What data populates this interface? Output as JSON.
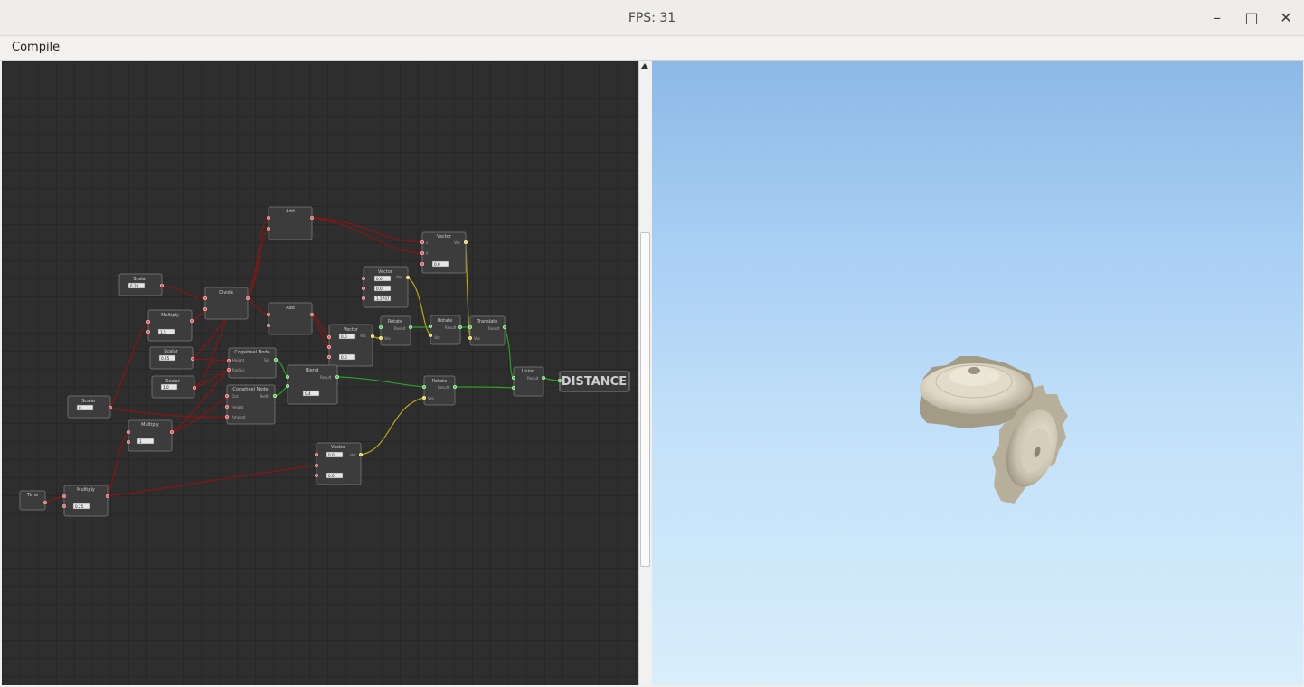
{
  "window": {
    "title": "FPS: 31",
    "minimize_glyph": "–",
    "maximize_glyph": "□",
    "close_glyph": "✕"
  },
  "menu": {
    "items": [
      {
        "label": "Compile"
      }
    ]
  },
  "graph": {
    "output_label": "DISTANCE",
    "nodes": [
      {
        "title": "Add",
        "inputs": [],
        "values": []
      },
      {
        "title": "Vector",
        "inputs": [
          "x",
          "y",
          "z"
        ],
        "outputs": [
          "Vec"
        ],
        "values": [
          "0.0"
        ]
      },
      {
        "title": "Scalar",
        "values": [
          "6.28"
        ]
      },
      {
        "title": "Divide",
        "values": []
      },
      {
        "title": "Vector",
        "outputs": [
          "Vec"
        ],
        "values": [
          "0.0",
          "0.0",
          "1.5707"
        ]
      },
      {
        "title": "Multiply",
        "values": [
          "1.5"
        ]
      },
      {
        "title": "Add",
        "values": []
      },
      {
        "title": "Vector",
        "outputs": [
          "Vec"
        ],
        "values": [
          "0.0",
          "0.0"
        ]
      },
      {
        "title": "Rotate",
        "inputs": [
          "Vec"
        ],
        "outputs": [
          "Result"
        ]
      },
      {
        "title": "Rotate",
        "inputs": [
          "Vec"
        ],
        "outputs": [
          "Result"
        ]
      },
      {
        "title": "Translate",
        "inputs": [
          "Vec"
        ],
        "outputs": [
          "Result"
        ]
      },
      {
        "title": "Scalar",
        "values": [
          "0.25"
        ]
      },
      {
        "title": "Cogwheel Node",
        "inputs": [
          "Height",
          "Radius"
        ],
        "outputs": [
          "Sig"
        ]
      },
      {
        "title": "Blend",
        "outputs": [
          "Result"
        ],
        "values": [
          "0.4"
        ]
      },
      {
        "title": "Scalar",
        "values": [
          "1.0"
        ]
      },
      {
        "title": "Cogwheel Node",
        "inputs": [
          "Dist",
          "Height",
          "Amount"
        ],
        "outputs": [
          "Teeth"
        ]
      },
      {
        "title": "Rotate",
        "inputs": [
          "Vec"
        ],
        "outputs": [
          "Result"
        ]
      },
      {
        "title": "Union",
        "outputs": [
          "Result"
        ]
      },
      {
        "title": "Scalar",
        "values": [
          "8"
        ]
      },
      {
        "title": "Multiply",
        "values": [
          "1"
        ]
      },
      {
        "title": "Vector",
        "outputs": [
          "Vec"
        ],
        "values": [
          "0.0",
          "0.0"
        ]
      },
      {
        "title": "Time"
      },
      {
        "title": "Multiply",
        "values": [
          "0.25"
        ]
      }
    ]
  },
  "colors": {
    "wire_scalar": "#8a1414",
    "wire_vector": "#b8a51e",
    "wire_sdf": "#2aa02a",
    "node_bg": "#3d3d3d"
  }
}
